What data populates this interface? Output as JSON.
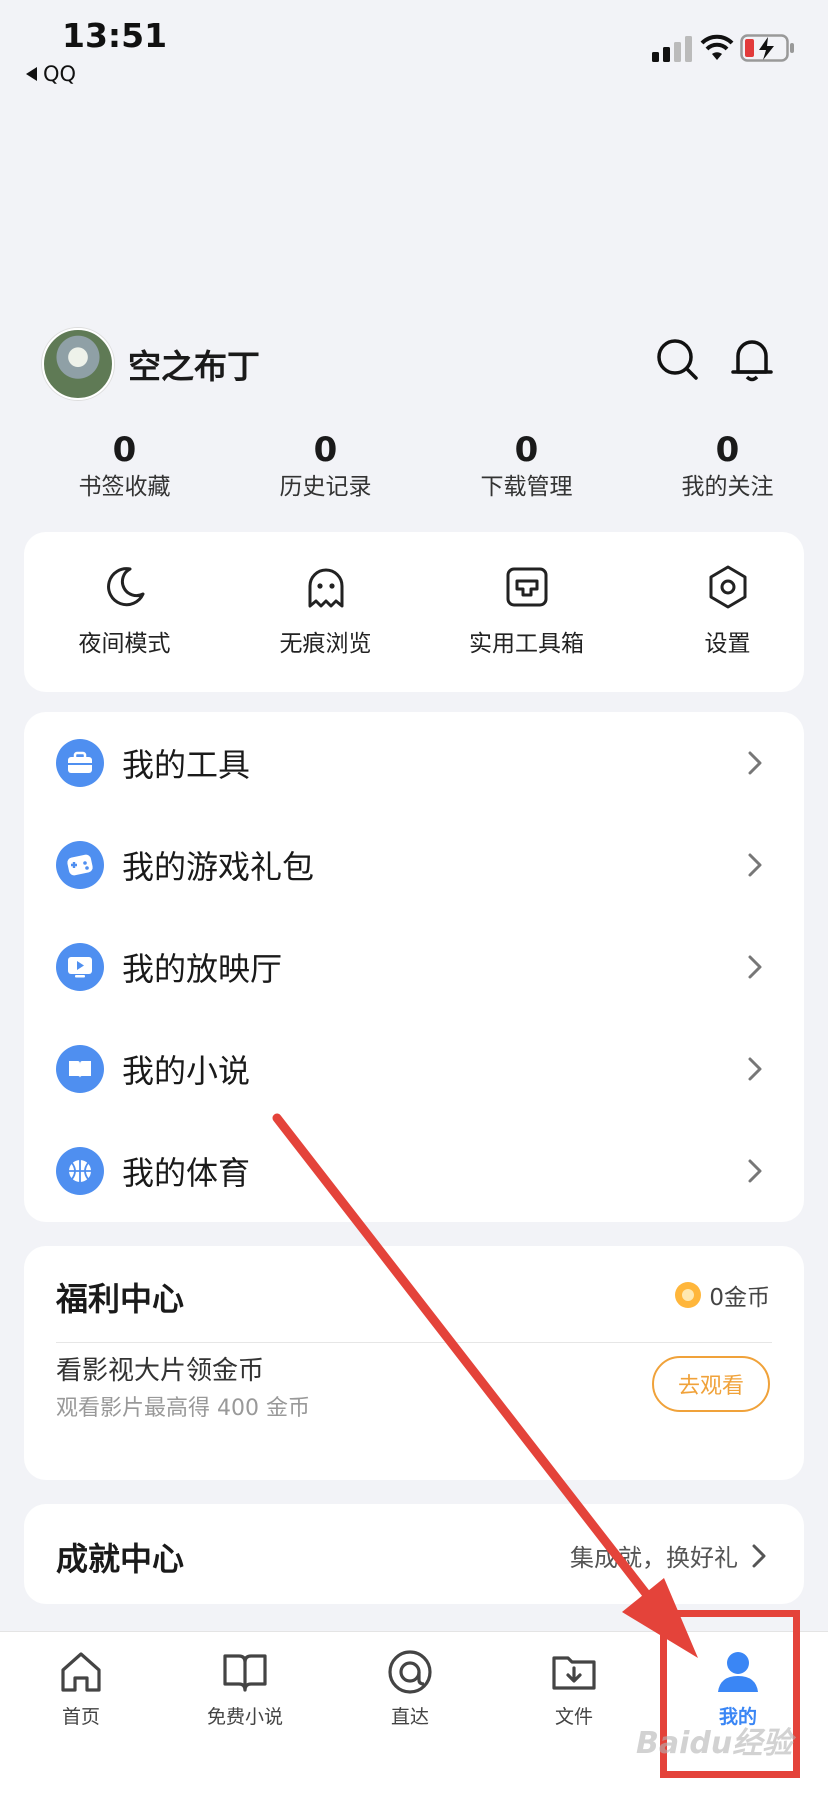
{
  "status_bar": {
    "time": "13:51",
    "back_app": "QQ"
  },
  "profile": {
    "username": "空之布丁"
  },
  "stats": [
    {
      "value": "0",
      "label": "书签收藏"
    },
    {
      "value": "0",
      "label": "历史记录"
    },
    {
      "value": "0",
      "label": "下载管理"
    },
    {
      "value": "0",
      "label": "我的关注"
    }
  ],
  "quick_actions": [
    {
      "label": "夜间模式",
      "icon": "moon-icon"
    },
    {
      "label": "无痕浏览",
      "icon": "ghost-icon"
    },
    {
      "label": "实用工具箱",
      "icon": "toolbox-icon"
    },
    {
      "label": "设置",
      "icon": "settings-icon"
    }
  ],
  "menu": [
    {
      "label": "我的工具",
      "icon": "briefcase-icon"
    },
    {
      "label": "我的游戏礼包",
      "icon": "gamepad-icon"
    },
    {
      "label": "我的放映厅",
      "icon": "play-screen-icon"
    },
    {
      "label": "我的小说",
      "icon": "book-icon"
    },
    {
      "label": "我的体育",
      "icon": "basketball-icon"
    }
  ],
  "welfare": {
    "title": "福利中心",
    "coins": "0金币",
    "task_title": "看影视大片领金币",
    "task_sub": "观看影片最高得 400 金币",
    "button": "去观看"
  },
  "achievement": {
    "title": "成就中心",
    "link": "集成就，换好礼"
  },
  "tabs": [
    {
      "label": "首页",
      "icon": "home-icon"
    },
    {
      "label": "免费小说",
      "icon": "open-book-icon"
    },
    {
      "label": "直达",
      "icon": "direct-icon"
    },
    {
      "label": "文件",
      "icon": "folder-download-icon"
    },
    {
      "label": "我的",
      "icon": "user-icon",
      "active": true
    }
  ],
  "watermark": "Baidu经验",
  "colors": {
    "accent": "#3a86f5",
    "icon_blue": "#4f8ff0",
    "annotation_red": "#e4433a",
    "coin_orange": "#f0a23a"
  }
}
